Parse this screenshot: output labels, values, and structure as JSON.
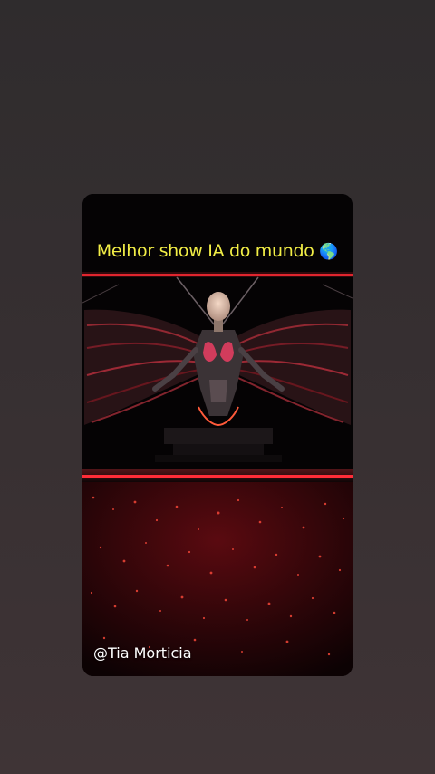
{
  "post": {
    "caption": "Melhor show IA do mundo",
    "caption_emoji": "🌎",
    "handle": "@Tia Morticia"
  },
  "colors": {
    "background": "#322e2f",
    "caption": "#f2ee46",
    "stage_light": "#ff2a35",
    "handle_text": "#ffffff"
  },
  "icons": {
    "caption_emoji": "globe-americas-icon"
  }
}
